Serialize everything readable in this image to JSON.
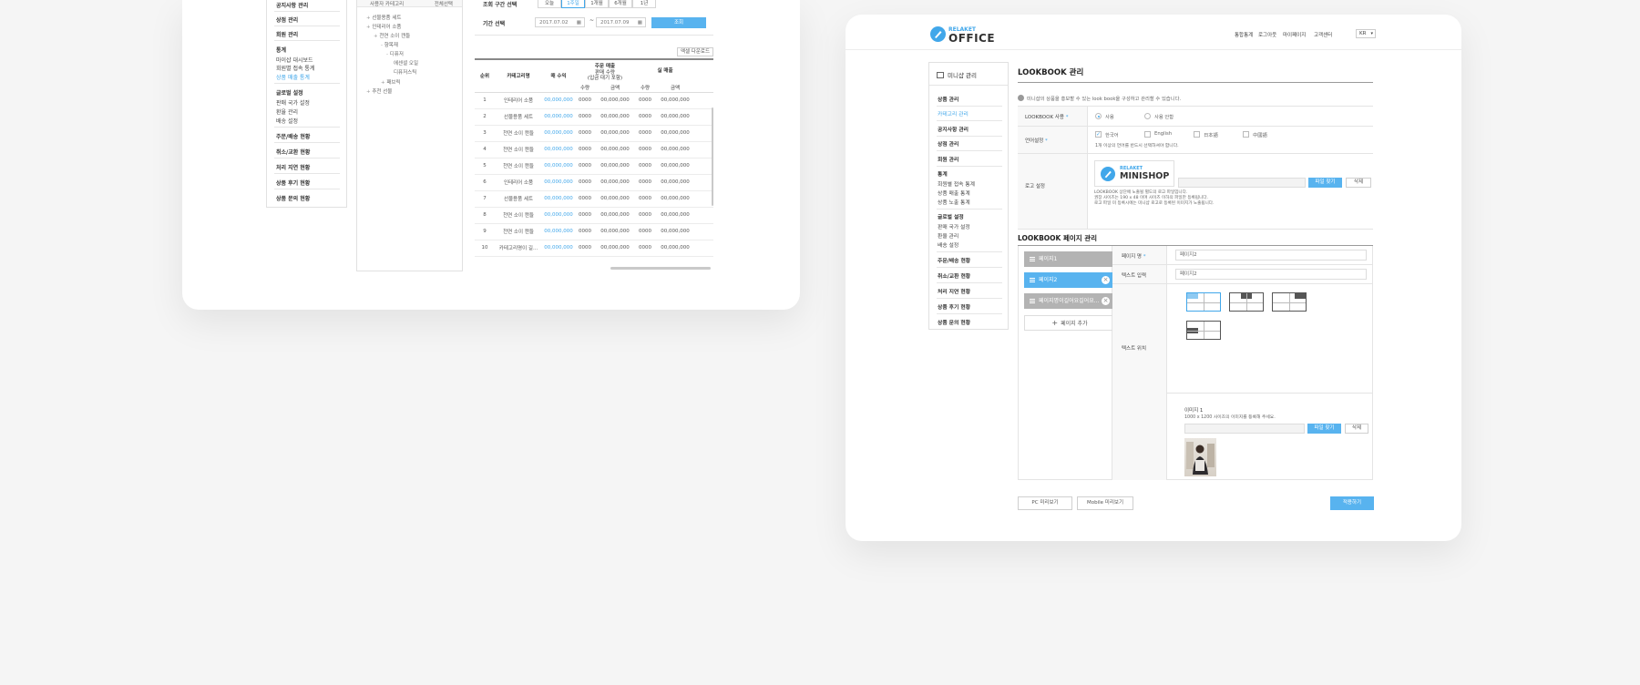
{
  "left_screen": {
    "sidebar": {
      "items": [
        {
          "label": "공지사항 관리",
          "style": "bold"
        },
        {
          "label": "상점 관리",
          "style": "bold"
        },
        {
          "label": "회원 관리",
          "style": "bold"
        },
        {
          "label": "통계",
          "style": "bold"
        },
        {
          "label": "마이샵 대시보드",
          "style": "normal"
        },
        {
          "label": "회원별 접속 통계",
          "style": "normal"
        },
        {
          "label": "상품 매출 통계",
          "style": "active"
        },
        {
          "label": "글로벌 설정",
          "style": "bold"
        },
        {
          "label": "판매 국가 설정",
          "style": "normal"
        },
        {
          "label": "환율 관리",
          "style": "normal"
        },
        {
          "label": "배송 설정",
          "style": "normal"
        },
        {
          "label": "주문/배송 현황",
          "style": "bold"
        },
        {
          "label": "취소/교환 현황",
          "style": "bold"
        },
        {
          "label": "처리 지연 현황",
          "style": "bold"
        },
        {
          "label": "상품 후기 현황",
          "style": "bold"
        },
        {
          "label": "상품 문의 현황",
          "style": "bold"
        }
      ]
    },
    "tree": {
      "header": "사용자 카테고리",
      "header_button": "전체선택",
      "items": [
        "선물용품 세트",
        "인테리어 소품",
        "천연 소이 캔들",
        "향목재",
        "디퓨저",
        "에센셜 오일",
        "디퓨저스틱",
        "패브릭",
        "추천 선물"
      ]
    },
    "filters": {
      "period_label": "조회 구간 선택",
      "period_buttons": [
        "오늘",
        "1주일",
        "1개월",
        "6개월",
        "1년"
      ],
      "date_label": "기간 선택",
      "start_date": "2017.07.02",
      "end_date": "2017.07.09",
      "tilde": "~",
      "search_button": "조회",
      "excel_button": "엑셀 다운로드"
    },
    "table": {
      "headers": {
        "rank": "순위",
        "category": "카테고리명",
        "revenue": "매 수익",
        "order_group": "주문 매출",
        "order_sub": "판매 수량\n(입금 대기 포함)",
        "actual_group": "실 매출",
        "qty": "수량",
        "amount": "금액"
      },
      "rows": [
        [
          "1",
          "인테리어 소품",
          "00,000,000",
          "0000",
          "00,000,000",
          "0000",
          "00,000,000"
        ],
        [
          "2",
          "선물용품 세트",
          "00,000,000",
          "0000",
          "00,000,000",
          "0000",
          "00,000,000"
        ],
        [
          "3",
          "천연 소이 캔들",
          "00,000,000",
          "0000",
          "00,000,000",
          "0000",
          "00,000,000"
        ],
        [
          "4",
          "천연 소이 캔들",
          "00,000,000",
          "0000",
          "00,000,000",
          "0000",
          "00,000,000"
        ],
        [
          "5",
          "천연 소이 캔들",
          "00,000,000",
          "0000",
          "00,000,000",
          "0000",
          "00,000,000"
        ],
        [
          "6",
          "인테리어 소품",
          "00,000,000",
          "0000",
          "00,000,000",
          "0000",
          "00,000,000"
        ],
        [
          "7",
          "선물용품 세트",
          "00,000,000",
          "0000",
          "00,000,000",
          "0000",
          "00,000,000"
        ],
        [
          "8",
          "천연 소이 캔들",
          "00,000,000",
          "0000",
          "00,000,000",
          "0000",
          "00,000,000"
        ],
        [
          "9",
          "천연 소이 캔들",
          "00,000,000",
          "0000",
          "00,000,000",
          "0000",
          "00,000,000"
        ],
        [
          "10",
          "카테고리명이 길...",
          "00,000,000",
          "0000",
          "00,000,000",
          "0000",
          "00,000,000"
        ]
      ]
    }
  },
  "right_screen": {
    "logo": {
      "small": "RELAKET",
      "big": "OFFICE"
    },
    "nav": [
      "통합통계",
      "로그아웃",
      "마이페이지",
      "고객센터"
    ],
    "lang_select": "KR",
    "sidebar": {
      "title": "미니샵 관리",
      "items": [
        {
          "label": "상품 관리",
          "style": "bold"
        },
        {
          "label": "카테고리 관리",
          "style": "active"
        },
        {
          "label": "공지사항 관리",
          "style": "bold"
        },
        {
          "label": "상점 관리",
          "style": "bold"
        },
        {
          "label": "회원 관리",
          "style": "bold"
        },
        {
          "label": "통계",
          "style": "bold"
        },
        {
          "label": "회원별 접속 통계",
          "style": "normal"
        },
        {
          "label": "상품 매출 통계",
          "style": "normal"
        },
        {
          "label": "상품 노출 통계",
          "style": "normal"
        },
        {
          "label": "글로벌 설정",
          "style": "bold"
        },
        {
          "label": "판매 국가 설정",
          "style": "normal"
        },
        {
          "label": "환율 관리",
          "style": "normal"
        },
        {
          "label": "배송 설정",
          "style": "normal"
        },
        {
          "label": "주문/배송 현황",
          "style": "bold"
        },
        {
          "label": "취소/교환 현황",
          "style": "bold"
        },
        {
          "label": "처리 지연 현황",
          "style": "bold"
        },
        {
          "label": "상품 후기 현황",
          "style": "bold"
        },
        {
          "label": "상품 문의 현황",
          "style": "bold"
        }
      ]
    },
    "lookbook": {
      "title": "LOOKBOOK 관리",
      "info": "미니샵의 상품을 홍보할 수 있는 look book을 구성하고 관리할 수 있습니다.",
      "use_label": "LOOKBOOK 사용",
      "use_options": [
        "사용",
        "사용 안함"
      ],
      "lang_label": "언어설정",
      "lang_options": [
        "한국어",
        "English",
        "日本語",
        "中國語"
      ],
      "lang_hint": "1개 이상의 언어를 반드시 선택하셔야 합니다.",
      "logo_label": "로고 설정",
      "logo_preview_small": "RELAKET",
      "logo_preview_big": "MINISHOP",
      "logo_find": "파일 찾기",
      "logo_delete": "삭제",
      "logo_desc": [
        "LOOKBOOK 상단에 노출될 별도의 로고 파일입니다.",
        "권장 사이즈는 190 x 48 이며 사이즈 이하의 파일만 등록됩니다.",
        "로고 파일 미 등록시에는 미니샵 로고로 등록된 이미지가 노출됩니다."
      ]
    },
    "page_mgmt": {
      "title": "LOOKBOOK 페이지 관리",
      "pages": [
        {
          "label": "페이지1",
          "state": "gray",
          "closable": false
        },
        {
          "label": "페이지2",
          "state": "active",
          "closable": true
        },
        {
          "label": "페이지명이길어요길어요...",
          "state": "gray",
          "closable": true
        }
      ],
      "add_page": "페이지 추가",
      "page_name_label": "페이지 명",
      "page_name_value": "페이지2",
      "text_input_label": "텍스트 입력",
      "text_input_value": "페이지2",
      "text_pos_label": "텍스트 위치",
      "image_label": "이미지 1",
      "image_hint": "1000 x 1200 사이즈의 이미지를 등록해 주세요.",
      "image_find": "파일 찾기",
      "image_delete": "삭제"
    },
    "footer": {
      "pc_preview": "PC 미리보기",
      "mobile_preview": "Mobile 미리보기",
      "save": "적용하기"
    }
  }
}
